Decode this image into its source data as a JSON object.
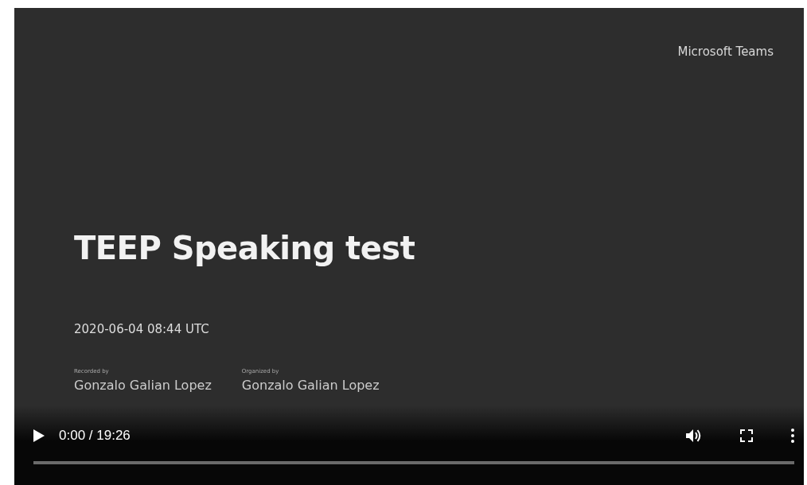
{
  "slide": {
    "brand": "Microsoft Teams",
    "title": "TEEP Speaking test",
    "date": "2020-06-04 08:44 UTC",
    "people": [
      {
        "label": "Recorded by",
        "name": "Gonzalo Galian Lopez"
      },
      {
        "label": "Organized by",
        "name": "Gonzalo Galian Lopez"
      }
    ]
  },
  "player": {
    "playing": false,
    "time": "0:00 / 19:26",
    "progress": {
      "level": 0
    }
  }
}
